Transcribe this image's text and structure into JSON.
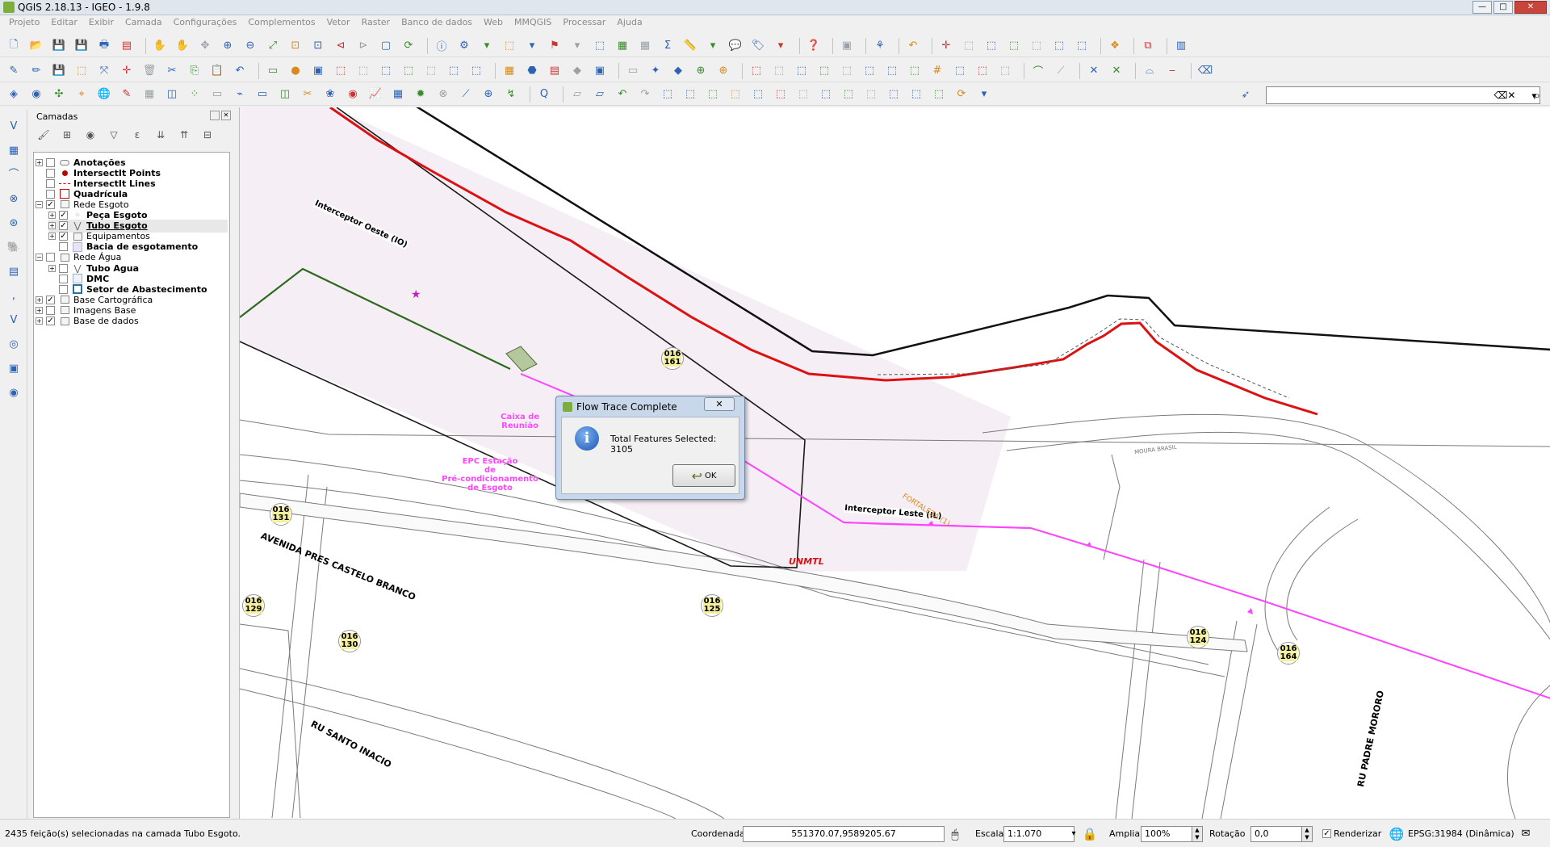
{
  "window": {
    "title": "QGIS 2.18.13 - IGEO - 1.9.8",
    "min_glyph": "—",
    "max_glyph": "□",
    "close_glyph": "✕"
  },
  "menu": [
    "Projeto",
    "Editar",
    "Exibir",
    "Camada",
    "Configurações",
    "Complementos",
    "Vetor",
    "Raster",
    "Banco de dados",
    "Web",
    "MMQGIS",
    "Processar",
    "Ajuda"
  ],
  "toolbar_search": {
    "value": "",
    "clear_glyph": "⌫✕",
    "go_glyph": "⌕",
    "dropdown_glyph": "▾"
  },
  "layers_panel": {
    "title": "Camadas",
    "close_glyph": "✕",
    "tree": [
      {
        "label": "Anotações",
        "checked": false,
        "bold": true,
        "indent": 0,
        "expander": "+",
        "symbol": "annotation-icon"
      },
      {
        "label": "IntersectIt Points",
        "checked": false,
        "bold": true,
        "indent": 0,
        "expander": "",
        "symbol": "red-point-icon"
      },
      {
        "label": "IntersectIt Lines",
        "checked": false,
        "bold": true,
        "indent": 0,
        "expander": "",
        "symbol": "red-dashed-line-icon"
      },
      {
        "label": "Quadrícula",
        "checked": false,
        "bold": true,
        "indent": 0,
        "expander": "",
        "symbol": "red-square-icon"
      },
      {
        "label": "Rede Esgoto",
        "checked": true,
        "bold": false,
        "indent": 0,
        "expander": "−",
        "symbol": "group-icon"
      },
      {
        "label": "Peça Esgoto",
        "checked": true,
        "bold": true,
        "indent": 1,
        "expander": "+",
        "symbol": "points-icon"
      },
      {
        "label": "Tubo Esgoto",
        "checked": true,
        "bold": true,
        "indent": 1,
        "expander": "+",
        "symbol": "line-icon",
        "selected": true
      },
      {
        "label": "Equipamentos",
        "checked": true,
        "bold": false,
        "indent": 1,
        "expander": "+",
        "symbol": "group-icon"
      },
      {
        "label": "Bacia de esgotamento",
        "checked": false,
        "bold": true,
        "indent": 1,
        "expander": "",
        "symbol": "polygon-lilac-icon"
      },
      {
        "label": "Rede Água",
        "checked": false,
        "bold": false,
        "indent": 0,
        "expander": "−",
        "symbol": "group-icon"
      },
      {
        "label": "Tubo Agua",
        "checked": false,
        "bold": true,
        "indent": 1,
        "expander": "+",
        "symbol": "line-icon"
      },
      {
        "label": "DMC",
        "checked": false,
        "bold": true,
        "indent": 1,
        "expander": "",
        "symbol": "polygon-blue-icon"
      },
      {
        "label": "Setor de Abastecimento",
        "checked": false,
        "bold": true,
        "indent": 1,
        "expander": "",
        "symbol": "polygon-blue-outline-icon"
      },
      {
        "label": "Base Cartográfica",
        "checked": true,
        "bold": false,
        "indent": 0,
        "expander": "+",
        "symbol": "group-icon"
      },
      {
        "label": "Imagens Base",
        "checked": false,
        "bold": false,
        "indent": 0,
        "expander": "+",
        "symbol": "group-icon"
      },
      {
        "label": "Base de dados",
        "checked": true,
        "bold": false,
        "indent": 0,
        "expander": "+",
        "symbol": "group-icon"
      }
    ]
  },
  "map": {
    "labels": {
      "interceptor_oeste": "Interceptor Oeste (IO)",
      "interceptor_leste": "Interceptor Leste (IL)",
      "caixa_reuniao_1": "Caixa de",
      "caixa_reuniao_2": "Reunião",
      "epc_1": "EPC Estação",
      "epc_2": "de",
      "epc_3": "Pré-condicionamento",
      "epc_4": "de Esgoto",
      "fortaleza": "FORTALEZA (1)",
      "moura_brasil": "MOURA BRASIL",
      "unmtl": "UNMTL",
      "avenida": "AVENIDA PRES CASTELO BRANCO",
      "rua_santo_inacio": "RU SANTO INACIO",
      "rua_padre_mororo": "RU PADRE MORORO"
    },
    "badges": [
      {
        "top": "016",
        "bottom": "161"
      },
      {
        "top": "016",
        "bottom": "131"
      },
      {
        "top": "016",
        "bottom": "129"
      },
      {
        "top": "016",
        "bottom": "125"
      },
      {
        "top": "016",
        "bottom": "130"
      },
      {
        "top": "016",
        "bottom": "124"
      },
      {
        "top": "016",
        "bottom": "164"
      }
    ],
    "colors": {
      "sewer_pipe": "#ff44ff",
      "interceptor_oeste": "#2d6a1f",
      "red_boundary": "#dd1111",
      "black_boundary": "#111111",
      "basin_fill": "#f5eef4",
      "road": "#7a7a7a",
      "badge_fill": "#f4f0a0"
    }
  },
  "dialog": {
    "title": "Flow Trace Complete",
    "message": "Total Features Selected: 3105",
    "ok_label": "OK",
    "close_glyph": "✕",
    "info_glyph": "i"
  },
  "statusbar": {
    "message": "2435 feição(s) selecionadas na camada Tubo Esgoto.",
    "coord_label": "Coordenada",
    "coord_value": "551370.07,9589205.67",
    "scale_label": "Escala",
    "scale_value": "1:1.070",
    "zoom_label": "Ampliar",
    "zoom_value": "100%",
    "rotation_label": "Rotação",
    "rotation_value": "0,0",
    "render_label": "Renderizar",
    "render_checked": true,
    "crs_label": "EPSG:31984 (Dinâmica)"
  }
}
